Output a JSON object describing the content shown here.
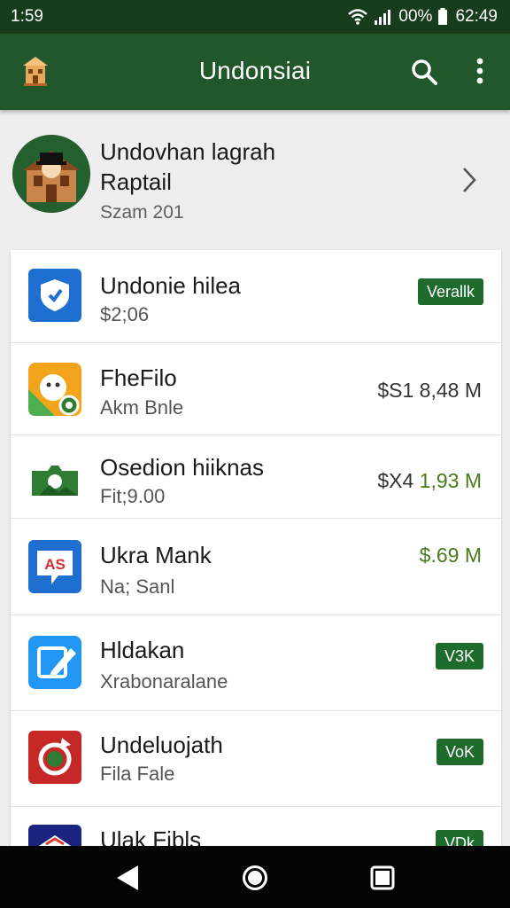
{
  "status": {
    "time_left": "1:59",
    "battery": "00%",
    "time_right": "62:49"
  },
  "appbar": {
    "title": "Undonsiai"
  },
  "profile": {
    "name": "Undovhan lagrah",
    "subtitle": "Raptail",
    "meta": "Szam 201"
  },
  "items": [
    {
      "title": "Undonie hilea",
      "subtitle": "$2;06",
      "badge": "Verallk",
      "icon": "shield-app-icon",
      "color": "#1f6fd0"
    },
    {
      "title": "FheFilo",
      "subtitle": "Akm Bnle",
      "price": "$S1  8,48 M",
      "icon": "chat-bubble-app-icon",
      "color": "#f2a51c"
    },
    {
      "title": "Osedion hiiknas",
      "subtitle": "Fit;9.00",
      "price_prefix": "$X4",
      "price": "1,93 M",
      "icon": "photo-app-icon",
      "color": "#2e7d32"
    },
    {
      "title": "Ukra Mank",
      "subtitle": "Na; Sanl",
      "price": "$.69 M",
      "icon": "ad-chat-app-icon",
      "color": "#1f6fd0"
    },
    {
      "title": "Hldakan",
      "subtitle": "Xrabonaralane",
      "badge": "V3K",
      "icon": "edit-app-icon",
      "color": "#2196f3"
    },
    {
      "title": "Undeluojath",
      "subtitle": "Fila Fale",
      "badge": "VoK",
      "icon": "refresh-app-icon",
      "color": "#c62828"
    },
    {
      "title": "Ulak Fibls",
      "badge": "VDk",
      "icon": "mail-app-icon",
      "color": "#1a237e"
    }
  ]
}
